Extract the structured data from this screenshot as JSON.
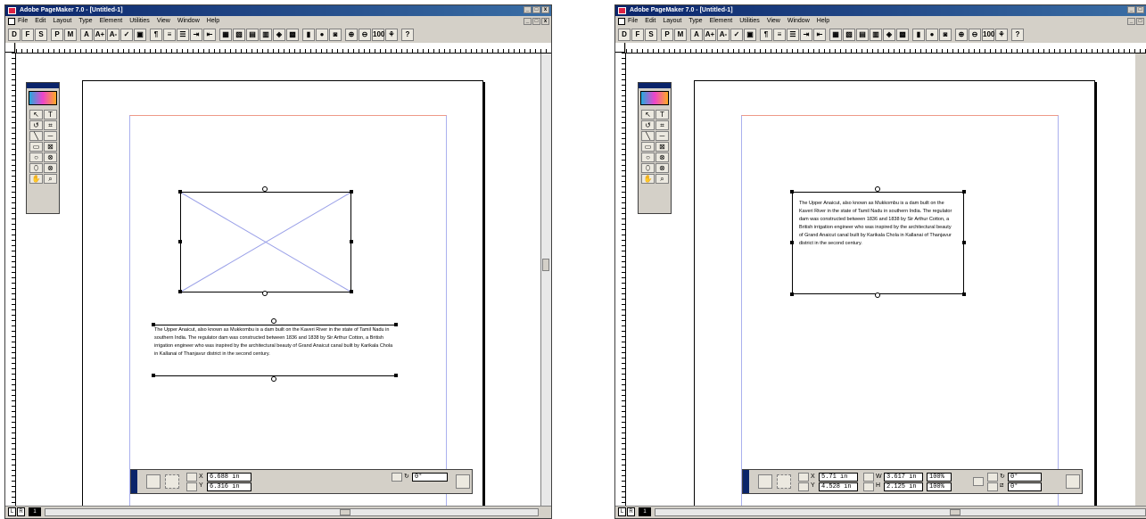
{
  "app_title": "Adobe PageMaker 7.0 - [Untitled-1]",
  "menu": [
    "File",
    "Edit",
    "Layout",
    "Type",
    "Element",
    "Utilities",
    "View",
    "Window",
    "Help"
  ],
  "window_controls": {
    "minimize": "_",
    "maximize": "□",
    "close": "x"
  },
  "toolbar": [
    "D",
    "F",
    "S",
    "P",
    "M",
    "A",
    "A+",
    "A-",
    "✓",
    "▣",
    "¶",
    "≡",
    "☰",
    "⇥",
    "⇤",
    "▦",
    "▧",
    "▤",
    "▥",
    "◈",
    "▩",
    "▮",
    "●",
    "◙",
    "⊕",
    "⊖",
    "100",
    "⚘",
    "?"
  ],
  "tools": [
    "↖",
    "T",
    "↺",
    "⌗",
    "╲",
    "─",
    "▭",
    "⊠",
    "○",
    "⊗",
    "⬯",
    "⊗",
    "✋",
    "⌕"
  ],
  "article_text": "The Upper Anaicut, also known as Mukkombu is a dam built on the Kaveri River in the state of Tamil Nadu in southern India. The regulator dam was constructed between 1836 and 1838 by Sir Arthur Cotton, a British irrigation engineer who was inspired by the architectural beauty of Grand Anaicut canal built by Karikala Chola in Kallanai of Thanjavur district in the second century.",
  "left_window": {
    "control_palette": {
      "x_label": "X",
      "y_label": "Y",
      "x_value": "6.688 in",
      "y_value": "6.316 in",
      "rotation": "0°"
    }
  },
  "right_window": {
    "control_palette": {
      "x_label": "X",
      "y_label": "Y",
      "x_value": "5.71 in",
      "y_value": "4.528 in",
      "w_label": "W",
      "h_label": "H",
      "w_value": "3.617 in",
      "h_value": "2.125 in",
      "w_scale": "100%",
      "h_scale": "100%",
      "rotation": "0°",
      "skew": "0°"
    }
  },
  "status": {
    "left_page": "L",
    "right_page": "R",
    "current_page": "1"
  },
  "colors": {
    "title_bar": "#0a246a",
    "chrome": "#d4d0c8",
    "margin_guide": "#aab0ee",
    "diagonal": "#9aa0e8"
  }
}
